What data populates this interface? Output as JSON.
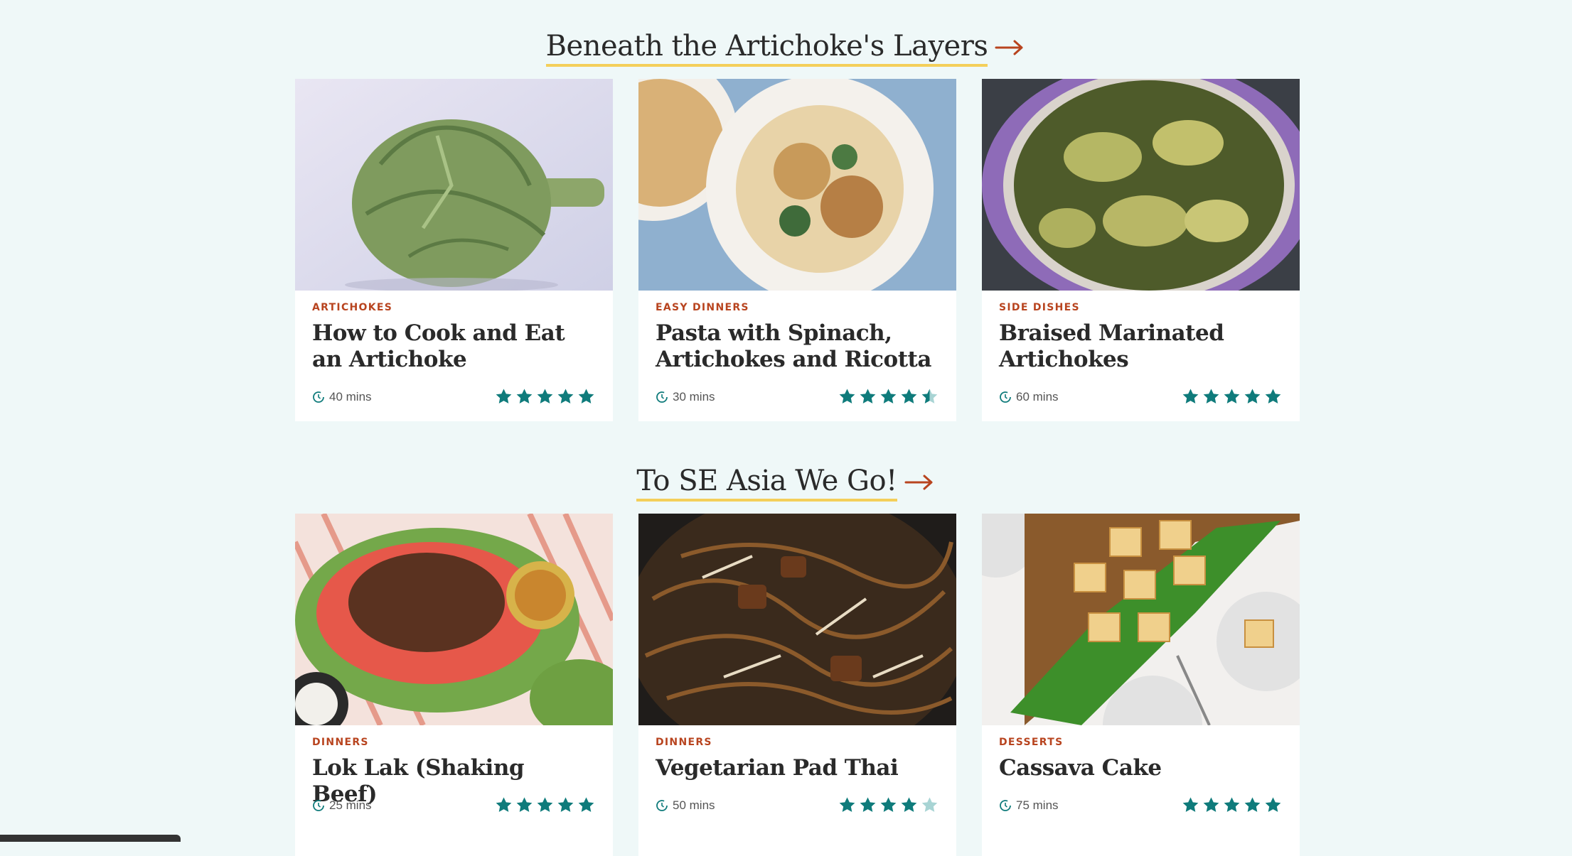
{
  "sections": [
    {
      "heading": "Beneath the Artichoke's Layers",
      "cards": [
        {
          "tag": "ARTICHOKES",
          "title": "How to Cook and Eat an Artichoke",
          "time": "40 mins",
          "rating": 5
        },
        {
          "tag": "EASY DINNERS",
          "title": "Pasta with Spinach, Artichokes and Ricotta",
          "time": "30 mins",
          "rating": 4.5
        },
        {
          "tag": "SIDE DISHES",
          "title": "Braised Marinated Artichokes",
          "time": "60 mins",
          "rating": 5
        }
      ]
    },
    {
      "heading": "To SE Asia We Go!",
      "cards": [
        {
          "tag": "DINNERS",
          "title": "Lok Lak (Shaking Beef)",
          "time": "25 mins",
          "rating": 5
        },
        {
          "tag": "DINNERS",
          "title": "Vegetarian Pad Thai",
          "time": "50 mins",
          "rating": 4
        },
        {
          "tag": "DESSERTS",
          "title": "Cassava Cake",
          "time": "75 mins",
          "rating": 5
        }
      ]
    }
  ],
  "icons": {
    "arrow": "arrow-right-icon",
    "clock": "clock-icon",
    "star": "star-icon"
  },
  "colors": {
    "accent": "#b8441f",
    "star": "#0f7b7b",
    "star_empty": "#a8d4d4",
    "underline": "#f4cf5a",
    "background": "#eff8f8"
  }
}
